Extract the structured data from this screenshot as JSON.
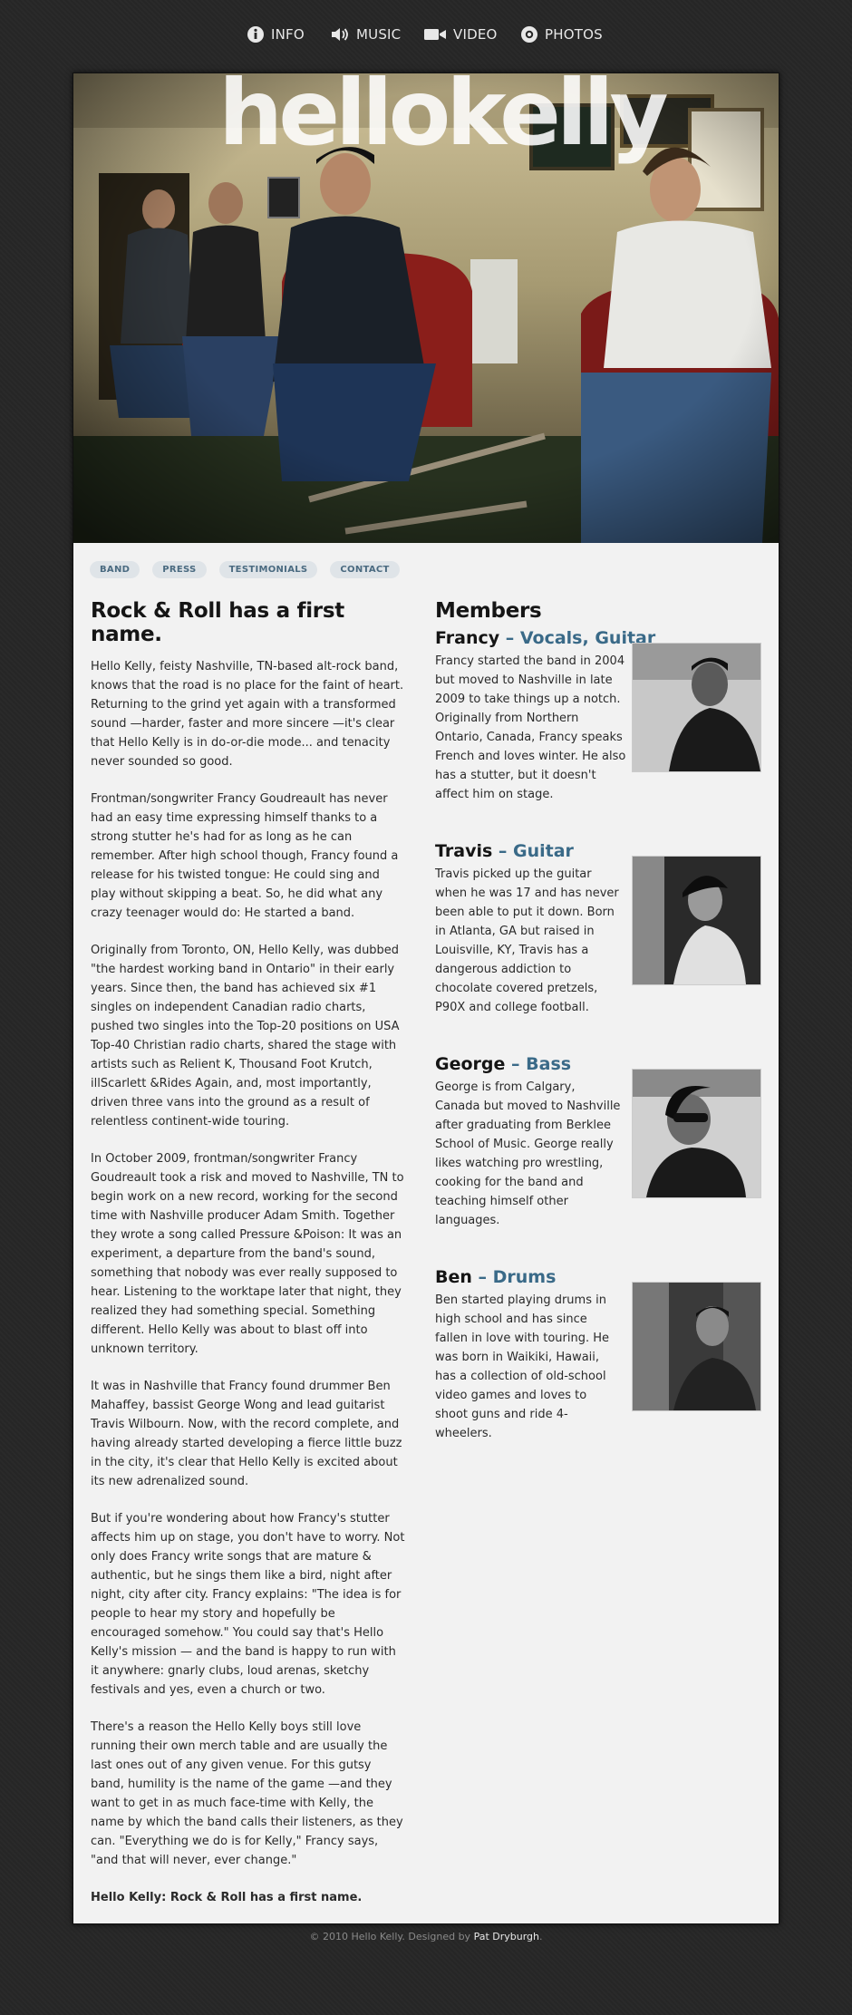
{
  "nav": {
    "info": "INFO",
    "music": "MUSIC",
    "video": "VIDEO",
    "photos": "PHOTOS"
  },
  "hero": {
    "logo": "hellokelly"
  },
  "subnav": [
    "BAND",
    "PRESS",
    "TESTIMONIALS",
    "CONTACT"
  ],
  "article": {
    "title": "Rock & Roll has a first name.",
    "paragraphs": [
      "Hello Kelly, feisty Nashville, TN-based alt-rock band, knows that the road is no place for the faint of heart. Returning to the grind yet again with a transformed sound —harder, faster and more sincere —it's clear that Hello Kelly is in do-or-die mode... and tenacity never sounded so good.",
      "Frontman/songwriter Francy Goudreault has never had an easy time expressing himself thanks to a strong stutter he's had for as long as he can remember. After high school though, Francy found a release for his twisted tongue: He could sing and play without skipping a beat. So, he did what any crazy teenager would do: He started a band.",
      "Originally from Toronto, ON, Hello Kelly, was dubbed \"the hardest working band in Ontario\" in their early years. Since then, the band has achieved six #1 singles on independent Canadian radio charts, pushed two singles into the Top-20 positions on USA Top-40 Christian radio charts, shared the stage with artists such as Relient K, Thousand Foot Krutch, illScarlett &Rides Again, and, most importantly, driven three vans into the ground as a result of relentless continent-wide touring.",
      "In October 2009, frontman/songwriter Francy Goudreault took a risk and moved to Nashville, TN to begin work on a new record, working for the second time with Nashville producer Adam Smith. Together they wrote a song called Pressure &Poison: It was an experiment, a departure from the band's sound, something that nobody was ever really supposed to hear. Listening to the worktape later that night, they realized they had something special. Something different. Hello Kelly was about to blast off into unknown territory.",
      "It was in Nashville that Francy found drummer Ben Mahaffey, bassist George Wong and lead guitarist Travis Wilbourn. Now, with the record complete, and having already started developing a fierce little buzz in the city, it's clear that Hello Kelly is excited about its new adrenalized sound.",
      "But if you're wondering about how Francy's stutter affects him up on stage, you don't have to worry. Not only does Francy write songs that are mature & authentic, but he sings them like a bird, night after night, city after city. Francy explains: \"The idea is for people to hear my story and hopefully be encouraged somehow.\" You could say that's Hello Kelly's mission — and the band is happy to run with it anywhere: gnarly clubs, loud arenas, sketchy festivals and yes, even a church or two.",
      "There's a reason the Hello Kelly boys still love running their own merch table and are usually the last ones out of any given venue. For this gutsy band, humility is the name of the game —and they want to get in as much face-time with Kelly, the name by which the band calls their listeners, as they can. \"Everything we do is for Kelly,\" Francy says, \"and that will never, ever change.\""
    ],
    "closing": "Hello Kelly: Rock & Roll has a first name."
  },
  "members": {
    "title": "Members",
    "list": [
      {
        "name": "Francy",
        "role": " – Vocals, Guitar",
        "bio": "Francy started the band in 2004 but moved to Nashville in late 2009 to take things up a notch. Originally from Northern Ontario, Canada, Francy speaks French and loves winter. He also has a stutter, but it doesn't affect him on stage."
      },
      {
        "name": "Travis",
        "role": " – Guitar",
        "bio": "Travis picked up the guitar when he was 17 and has never been able to put it down. Born in Atlanta, GA but raised in Louisville, KY, Travis has a dangerous addiction to chocolate covered pretzels, P90X and college football."
      },
      {
        "name": "George",
        "role": " – Bass",
        "bio": "George is from Calgary, Canada but moved to Nashville after graduating from Berklee School of Music. George really likes watching pro wrestling, cooking for the band and teaching himself other languages."
      },
      {
        "name": "Ben",
        "role": " – Drums",
        "bio": "Ben started playing drums in high school and has since fallen in love with touring. He was born in Waikiki, Hawaii, has a collection of old-school video games and loves to shoot guns and ride 4-wheelers."
      }
    ]
  },
  "footer": {
    "text": "© 2010 Hello Kelly. Designed by ",
    "link": "Pat Dryburgh",
    "end": "."
  },
  "colors": {
    "background": "#272727",
    "content": "#f2f2f2",
    "accent": "#3a6a88"
  }
}
